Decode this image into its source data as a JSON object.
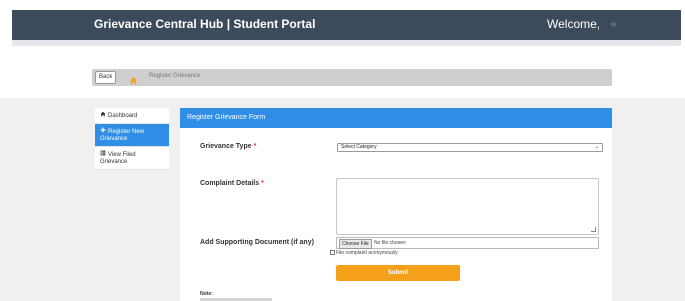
{
  "header": {
    "title": "Grievance Central Hub | Student Portal",
    "welcome": "Welcome,"
  },
  "breadcrumb": {
    "back_label": "Back",
    "current": "Register Grievance"
  },
  "sidebar": {
    "items": [
      {
        "label": "Dashboard",
        "icon": "home-icon"
      },
      {
        "label": "Register New Grievance",
        "icon": "plus-icon"
      },
      {
        "label": "View Filed Grievance",
        "icon": "list-icon"
      }
    ]
  },
  "form": {
    "heading": "Register Grievance Form",
    "type_label": "Grievance Type",
    "type_value": "Select Category",
    "details_label": "Complaint Details",
    "doc_label": "Add Supporting Document (if any)",
    "file_button": "Choose File",
    "file_status": "No file chosen",
    "anonymous_label": "File complaint anonymously",
    "submit_label": "Submit",
    "note_label": "Note:",
    "required_mark": "*"
  },
  "colors": {
    "topbar": "#3d4a5c",
    "primary": "#2f8fe6",
    "submit": "#f5a01a",
    "home_icon": "#f0a030",
    "required": "#d9312b"
  }
}
